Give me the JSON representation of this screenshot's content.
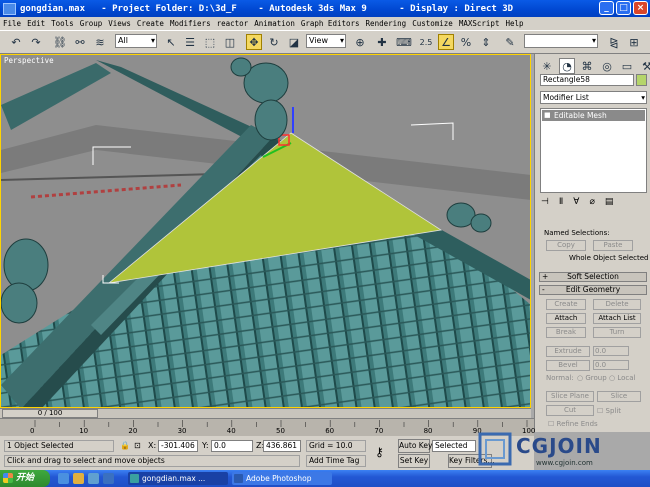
{
  "window": {
    "title": "gongdian.max   - Project Folder: D:\\3d_F    - Autodesk 3ds Max 9      - Display : Direct 3D"
  },
  "menu": [
    "File",
    "Edit",
    "Tools",
    "Group",
    "Views",
    "Create",
    "Modifiers",
    "reactor",
    "Animation",
    "Graph Editors",
    "Rendering",
    "Customize",
    "MAXScript",
    "Help"
  ],
  "toolbar": {
    "selection_filter": "All",
    "reference_coord": "View",
    "snap_label": "2.5",
    "angle_snap": "3"
  },
  "viewport": {
    "label": "Perspective"
  },
  "command_panel": {
    "object_name": "Rectangle58",
    "object_color": "#b5d56a",
    "modifier_list": "Modifier List",
    "stack": [
      "Editable Mesh"
    ],
    "named_selections_label": "Named Selections:",
    "copy": "Copy",
    "paste": "Paste",
    "whole_object": "Whole Object Selected",
    "soft_selection": "Soft Selection",
    "edit_geometry": "Edit Geometry",
    "create": "Create",
    "delete": "Delete",
    "attach": "Attach",
    "attach_list": "Attach List",
    "break": "Break",
    "turn": "Turn",
    "extrude": "Extrude",
    "extrude_val": "0.0",
    "bevel": "Bevel",
    "bevel_val": "0.0",
    "normal": "Normal:",
    "group": "Group",
    "local": "Local",
    "slice_plane": "Slice Plane",
    "slice": "Slice",
    "cut": "Cut",
    "split": "Split",
    "refine_ends": "Refine Ends"
  },
  "time": {
    "slider": "0 / 100",
    "ticks": [
      "0",
      "10",
      "20",
      "30",
      "40",
      "50",
      "60",
      "70",
      "80",
      "90",
      "100"
    ]
  },
  "status": {
    "selected": "1 Object Selected",
    "prompt": "Click and drag to select and move objects",
    "x_label": "X:",
    "x": "-301.406",
    "y_label": "Y:",
    "y": "0.0",
    "z_label": "Z:",
    "z": "436.861",
    "grid": "Grid = 10.0",
    "add_time_tag": "Add Time Tag",
    "auto_key": "Auto Key",
    "set_key": "Set Key",
    "key_mode": "Selected",
    "key_filters": "Key Filters..."
  },
  "watermark": {
    "logo": "CGJOIN",
    "url": "www.cgjoin.com"
  },
  "taskbar": {
    "start": "开始",
    "tasks": [
      "gongdian.max ...",
      "Adobe Photoshop"
    ]
  }
}
